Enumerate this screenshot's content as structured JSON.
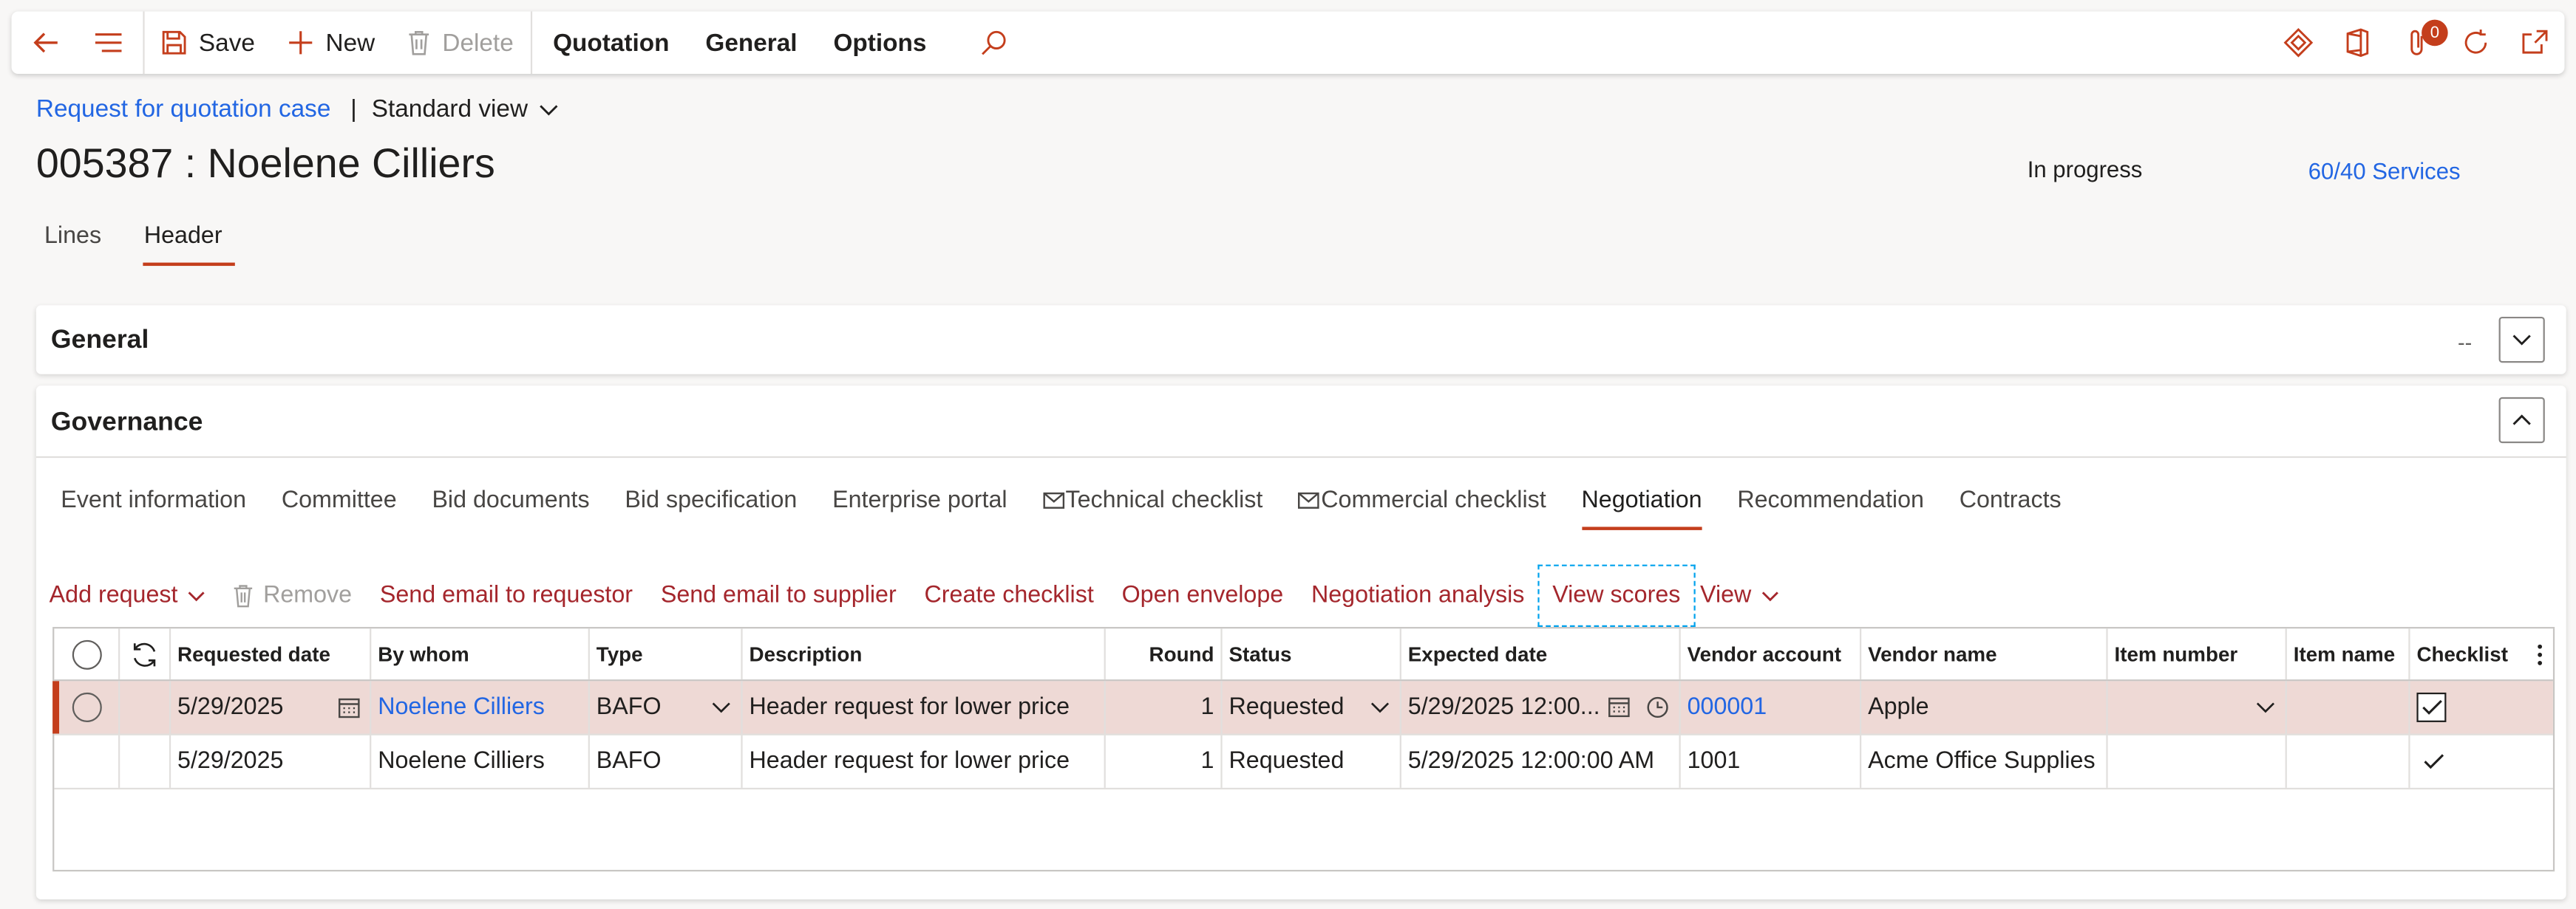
{
  "toolbar": {
    "save_label": "Save",
    "new_label": "New",
    "delete_label": "Delete",
    "menus": [
      "Quotation",
      "General",
      "Options"
    ],
    "notification_count": "0"
  },
  "breadcrumb": {
    "link": "Request for quotation case",
    "view": "Standard view"
  },
  "header": {
    "title": "005387 : Noelene Cilliers",
    "status": "In progress",
    "company": "60/40 Services"
  },
  "page_tabs": [
    "Lines",
    "Header"
  ],
  "general_card": {
    "title": "General",
    "summary": "--"
  },
  "governance": {
    "title": "Governance",
    "tabs": [
      "Event information",
      "Committee",
      "Bid documents",
      "Bid specification",
      "Enterprise portal",
      "Technical checklist",
      "Commercial checklist",
      "Negotiation",
      "Recommendation",
      "Contracts"
    ],
    "actions": {
      "add_request": "Add request",
      "remove": "Remove",
      "send_email_requestor": "Send email to requestor",
      "send_email_supplier": "Send email to supplier",
      "create_checklist": "Create checklist",
      "open_envelope": "Open envelope",
      "negotiation_analysis": "Negotiation analysis",
      "view_scores": "View scores",
      "view": "View"
    }
  },
  "grid": {
    "columns": [
      "Requested date",
      "By whom",
      "Type",
      "Description",
      "Round",
      "Status",
      "Expected date",
      "Vendor account",
      "Vendor name",
      "Item number",
      "Item name",
      "Checklist"
    ],
    "rows": [
      {
        "requested_date": "5/29/2025",
        "by_whom": "Noelene Cilliers",
        "type": "BAFO",
        "description": "Header request for lower price",
        "round": "1",
        "status": "Requested",
        "expected_date": "5/29/2025 12:00...",
        "vendor_account": "000001",
        "vendor_name": "Apple",
        "item_number": "",
        "item_name": "",
        "checklist": true
      },
      {
        "requested_date": "5/29/2025",
        "by_whom": "Noelene Cilliers",
        "type": "BAFO",
        "description": "Header request for lower price",
        "round": "1",
        "status": "Requested",
        "expected_date": "5/29/2025 12:00:00 AM",
        "vendor_account": "1001",
        "vendor_name": "Acme Office Supplies",
        "item_number": "",
        "item_name": "",
        "checklist": true
      }
    ]
  },
  "colors": {
    "accent": "#c43e1c",
    "link": "#2266e3",
    "action": "#a4262c",
    "selected_row": "#eed9d5"
  }
}
